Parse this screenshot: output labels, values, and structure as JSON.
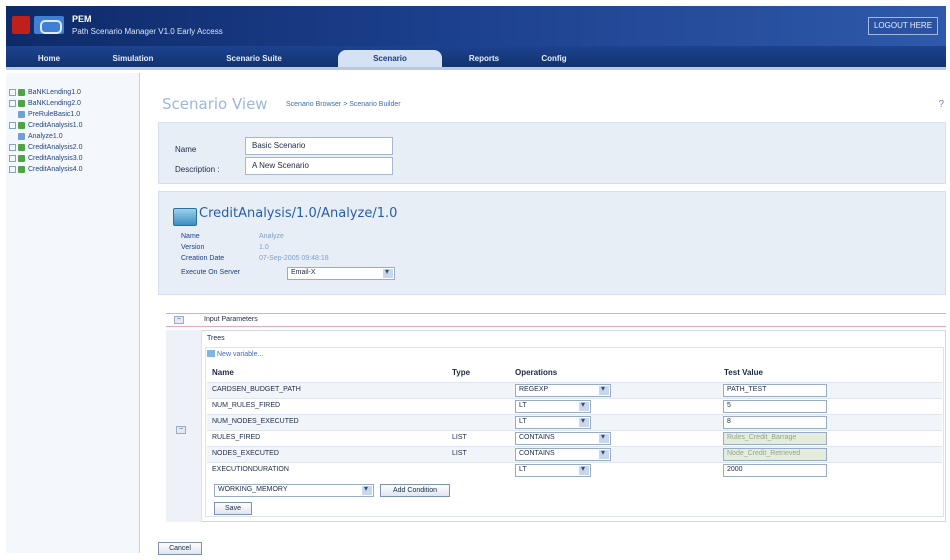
{
  "header": {
    "app_name": "PEM",
    "app_subtitle": "Path Scenario Manager V1.0 Early Access",
    "logout_label": "LOGOUT HERE"
  },
  "tabs": [
    {
      "label": "Home"
    },
    {
      "label": "Simulation"
    },
    {
      "label": "Scenario Suite"
    },
    {
      "label": "Scenario",
      "active": true
    },
    {
      "label": "Reports"
    },
    {
      "label": "Config"
    }
  ],
  "tree": {
    "items": [
      {
        "label": "BaNKLending1.0",
        "child": false
      },
      {
        "label": "BaNKLending2.0",
        "child": false
      },
      {
        "label": "PreRuleBasic1.0",
        "child": true
      },
      {
        "label": "CreditAnalysis1.0",
        "child": false
      },
      {
        "label": "Analyze1.0",
        "child": true
      },
      {
        "label": "CreditAnalysis2.0",
        "child": false
      },
      {
        "label": "CreditAnalysis3.0",
        "child": false
      },
      {
        "label": "CreditAnalysis4.0",
        "child": false
      }
    ]
  },
  "page": {
    "title": "Scenario View",
    "breadcrumb": "Scenario Browser > Scenario Builder",
    "help_label": "?"
  },
  "scenario": {
    "name_label": "Name",
    "name_value": "Basic Scenario",
    "description_label": "Description :",
    "description_value": "A New Scenario"
  },
  "service": {
    "title": "CreditAnalysis/1.0/Analyze/1.0",
    "fields": [
      {
        "label": "Name",
        "value": "Analyze"
      },
      {
        "label": "Version",
        "value": "1.0"
      },
      {
        "label": "Creation Date",
        "value": "07-Sep-2005 09:48:18"
      }
    ],
    "execute_label": "Execute On Server",
    "execute_value": "Email-X"
  },
  "input_params": {
    "section_label": "Input Parameters",
    "group_label": "Trees",
    "new_variable_label": "New variable...",
    "columns": [
      "Name",
      "Type",
      "Operations",
      "Test Value"
    ],
    "rows": [
      {
        "name": "CARDSEN_BUDGET_PATH",
        "type": "",
        "operation": "REGEXP",
        "value": "PATH_TEST",
        "disabled": false
      },
      {
        "name": "NUM_RULES_FIRED",
        "type": "",
        "operation": "LT",
        "value": "5",
        "disabled": false
      },
      {
        "name": "NUM_NODES_EXECUTED",
        "type": "",
        "operation": "LT",
        "value": "8",
        "disabled": false
      },
      {
        "name": "RULES_FIRED",
        "type": "LIST",
        "operation": "CONTAINS",
        "value": "Rules_Credit_Barrage",
        "disabled": true
      },
      {
        "name": "NODES_EXECUTED",
        "type": "LIST",
        "operation": "CONTAINS",
        "value": "Node_Credit_Retrieved",
        "disabled": true
      },
      {
        "name": "EXECUTIONDURATION",
        "type": "",
        "operation": "LT",
        "value": "2000",
        "disabled": false
      }
    ],
    "add_select_value": "WORKING_MEMORY",
    "add_condition_label": "Add Condition",
    "save_label": "Save"
  },
  "footer": {
    "cancel_label": "Cancel"
  },
  "colors": {
    "header_dark": "#0e2a68",
    "accent_blue": "#2a5ea8",
    "panel_bg": "#e7eef6"
  }
}
